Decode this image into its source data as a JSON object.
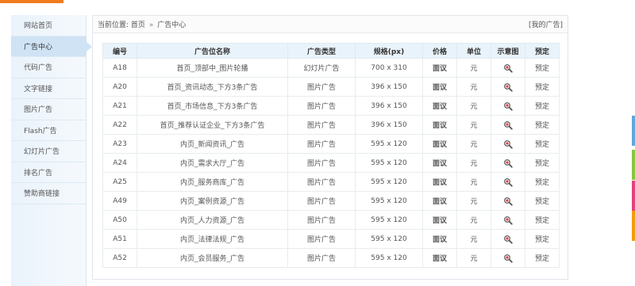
{
  "colors": {
    "accent": "#f07c1e",
    "price": "#e8531c",
    "header_bg": "#e9f3fb",
    "side_active": "#cfe3f5",
    "right_tabs": [
      "#5fa8dc",
      "#8cc63f",
      "#e0457b",
      "#f39c12"
    ]
  },
  "sidebar": {
    "items": [
      {
        "label": "网站首页",
        "active": false
      },
      {
        "label": "广告中心",
        "active": true
      },
      {
        "label": "代码广告",
        "active": false
      },
      {
        "label": "文字链接",
        "active": false
      },
      {
        "label": "图片广告",
        "active": false
      },
      {
        "label": "Flash广告",
        "active": false
      },
      {
        "label": "幻灯片广告",
        "active": false
      },
      {
        "label": "排名广告",
        "active": false
      },
      {
        "label": "赞助商链接",
        "active": false
      }
    ]
  },
  "header": {
    "location_label": "当前位置:",
    "crumbs": [
      "首页",
      "广告中心"
    ],
    "crumb_sep": "»",
    "my_ads": "[我的广告]"
  },
  "table": {
    "columns": [
      "编号",
      "广告位名称",
      "广告类型",
      "规格(px)",
      "价格",
      "单位",
      "示意图",
      "预定"
    ],
    "rows": [
      {
        "id": "A18",
        "name": "首页_顶部中_图片轮播",
        "type": "幻灯片广告",
        "size": "700 x 310",
        "price": "面议",
        "unit": "元",
        "preview_icon": "zoom-icon",
        "book": "预定"
      },
      {
        "id": "A20",
        "name": "首页_资讯动态_下方3条广告",
        "type": "图片广告",
        "size": "396 x 150",
        "price": "面议",
        "unit": "元",
        "preview_icon": "zoom-icon",
        "book": "预定"
      },
      {
        "id": "A21",
        "name": "首页_市场信息_下方3条广告",
        "type": "图片广告",
        "size": "396 x 150",
        "price": "面议",
        "unit": "元",
        "preview_icon": "zoom-icon",
        "book": "预定"
      },
      {
        "id": "A22",
        "name": "首页_推荐认证企业_下方3条广告",
        "type": "图片广告",
        "size": "396 x 150",
        "price": "面议",
        "unit": "元",
        "preview_icon": "zoom-icon",
        "book": "预定"
      },
      {
        "id": "A23",
        "name": "内页_新闻资讯_广告",
        "type": "图片广告",
        "size": "595 x 120",
        "price": "面议",
        "unit": "元",
        "preview_icon": "zoom-icon",
        "book": "预定"
      },
      {
        "id": "A24",
        "name": "内页_需求大厅_广告",
        "type": "图片广告",
        "size": "595 x 120",
        "price": "面议",
        "unit": "元",
        "preview_icon": "zoom-icon",
        "book": "预定"
      },
      {
        "id": "A25",
        "name": "内页_服务商库_广告",
        "type": "图片广告",
        "size": "595 x 120",
        "price": "面议",
        "unit": "元",
        "preview_icon": "zoom-icon",
        "book": "预定"
      },
      {
        "id": "A49",
        "name": "内页_案例资源_广告",
        "type": "图片广告",
        "size": "595 x 120",
        "price": "面议",
        "unit": "元",
        "preview_icon": "zoom-icon",
        "book": "预定"
      },
      {
        "id": "A50",
        "name": "内页_人力资源_广告",
        "type": "图片广告",
        "size": "595 x 120",
        "price": "面议",
        "unit": "元",
        "preview_icon": "zoom-icon",
        "book": "预定"
      },
      {
        "id": "A51",
        "name": "内页_法律法规_广告",
        "type": "图片广告",
        "size": "595 x 120",
        "price": "面议",
        "unit": "元",
        "preview_icon": "zoom-icon",
        "book": "预定"
      },
      {
        "id": "A52",
        "name": "内页_会员服务_广告",
        "type": "图片广告",
        "size": "595 x 120",
        "price": "面议",
        "unit": "元",
        "preview_icon": "zoom-icon",
        "book": "预定"
      }
    ]
  }
}
